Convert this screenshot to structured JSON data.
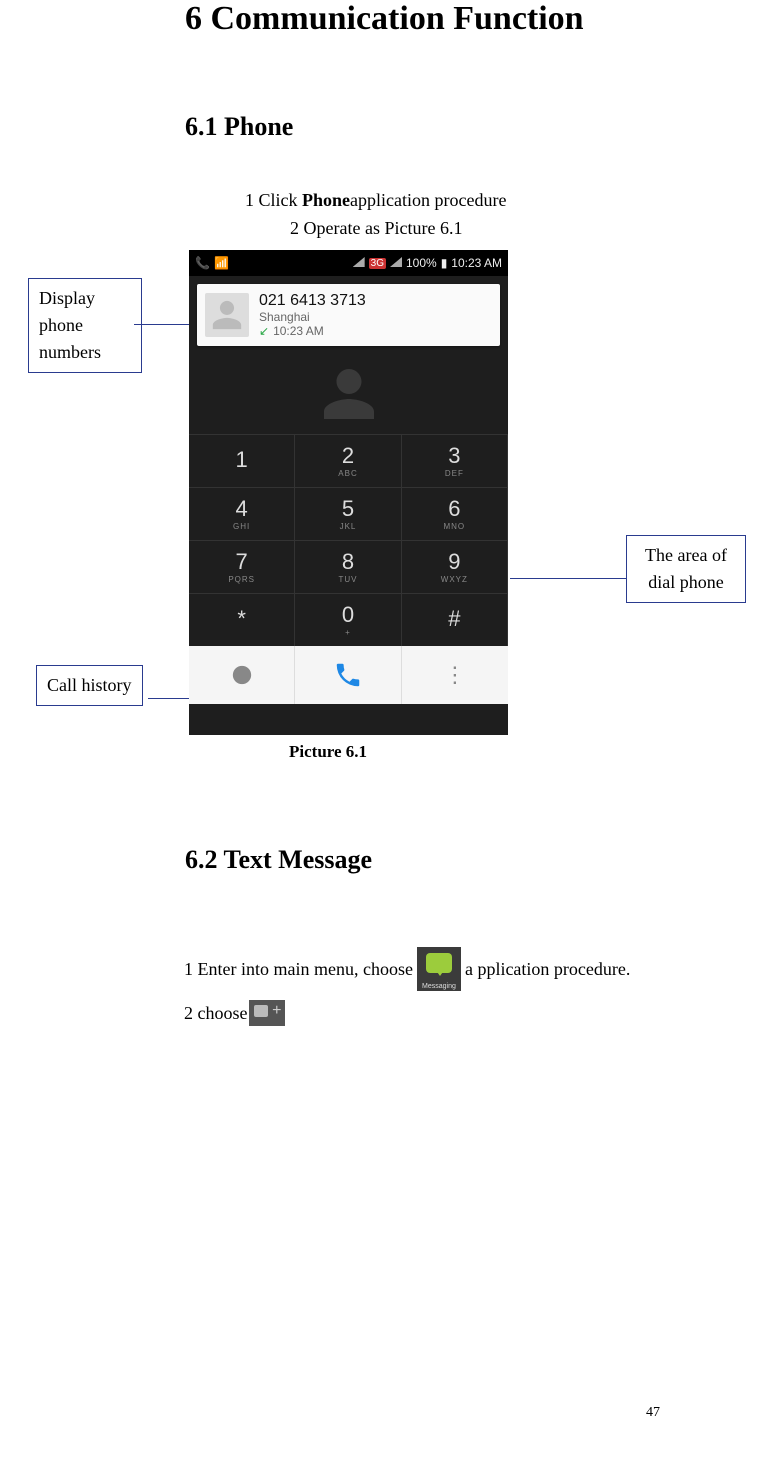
{
  "heading_main": "6 Communication Function",
  "section_phone": {
    "heading": "6.1 Phone",
    "step1_pre": "1 Click ",
    "step1_bold": "Phone",
    "step1_post": "application procedure",
    "step2": "2    Operate as Picture 6.1",
    "caption": "Picture 6.1"
  },
  "callouts": {
    "display": "Display phone numbers",
    "dial_area": "The area of dial phone",
    "history": "Call history"
  },
  "phone_ui": {
    "status": {
      "network": "3G",
      "battery": "100%",
      "time": "10:23 AM"
    },
    "recent": {
      "number": "021 6413 3713",
      "city": "Shanghai",
      "time": "10:23 AM"
    },
    "keys": [
      {
        "d": "1",
        "l": ""
      },
      {
        "d": "2",
        "l": "ABC"
      },
      {
        "d": "3",
        "l": "DEF"
      },
      {
        "d": "4",
        "l": "GHI"
      },
      {
        "d": "5",
        "l": "JKL"
      },
      {
        "d": "6",
        "l": "MNO"
      },
      {
        "d": "7",
        "l": "PQRS"
      },
      {
        "d": "8",
        "l": "TUV"
      },
      {
        "d": "9",
        "l": "WXYZ"
      },
      {
        "d": "*",
        "l": ""
      },
      {
        "d": "0",
        "l": "+"
      },
      {
        "d": "#",
        "l": ""
      }
    ]
  },
  "section_text": {
    "heading": "6.2 Text Message",
    "line1_pre": "1 Enter into main menu, choose ",
    "line1_post": " a pplication procedure.",
    "line2": "2 choose",
    "msg_label": "Messaging"
  },
  "page_number": "47"
}
